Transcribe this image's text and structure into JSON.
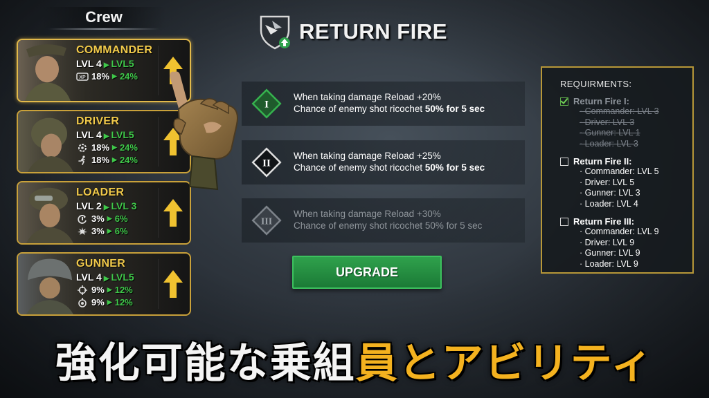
{
  "crew": {
    "title": "Crew",
    "members": [
      {
        "role": "COMMANDER",
        "level": "LVL 4",
        "next_level": "LVL5",
        "stats": [
          {
            "icon": "xp-icon",
            "value": "18%",
            "next": "24%"
          }
        ]
      },
      {
        "role": "DRIVER",
        "level": "LVL 4",
        "next_level": "LVL5",
        "stats": [
          {
            "icon": "gear-icon",
            "value": "18%",
            "next": "24%"
          },
          {
            "icon": "runner-icon",
            "value": "18%",
            "next": "24%"
          }
        ]
      },
      {
        "role": "LOADER",
        "level": "LVL 2",
        "next_level": "LVL 3",
        "stats": [
          {
            "icon": "reload-icon",
            "value": "3%",
            "next": "6%"
          },
          {
            "icon": "burst-icon",
            "value": "3%",
            "next": "6%"
          }
        ]
      },
      {
        "role": "GUNNER",
        "level": "LVL 4",
        "next_level": "LVL5",
        "stats": [
          {
            "icon": "crosshair-icon",
            "value": "9%",
            "next": "12%"
          },
          {
            "icon": "target-icon",
            "value": "9%",
            "next": "12%"
          }
        ]
      }
    ]
  },
  "ability": {
    "title": "RETURN FIRE",
    "tiers": [
      {
        "numeral": "I",
        "line1": "When taking damage Reload +20%",
        "line2_prefix": "Chance of enemy shot ricochet ",
        "line2_bold": "50% for 5 sec",
        "state": "active"
      },
      {
        "numeral": "II",
        "line1": "When taking damage Reload +25%",
        "line2_prefix": "Chance of enemy shot ricochet ",
        "line2_bold": "50% for 5 sec",
        "state": "available"
      },
      {
        "numeral": "III",
        "line1": "When taking damage Reload +30%",
        "line2_prefix": "Chance of enemy shot ricochet ",
        "line2_bold": "50% for 5 sec",
        "state": "locked"
      }
    ],
    "upgrade_label": "UPGRADE"
  },
  "requirements": {
    "title": "REQUIRMENTS:",
    "groups": [
      {
        "name": "Return Fire I:",
        "checked": true,
        "items": [
          "· Commander: LVL 3",
          "· Driver: LVL 3",
          "· Gunner: LVL 1",
          "· Loader: LVL 3"
        ]
      },
      {
        "name": "Return Fire II:",
        "checked": false,
        "items": [
          "· Commander: LVL 5",
          "· Driver: LVL 5",
          "· Gunner: LVL 3",
          "· Loader: LVL 4"
        ]
      },
      {
        "name": "Return Fire III:",
        "checked": false,
        "items": [
          "· Commander: LVL 9",
          "· Driver: LVL 9",
          "· Gunner: LVL 9",
          "· Loader: LVL 9"
        ]
      }
    ]
  },
  "banner": {
    "white_text": "強化可能な乗組",
    "yellow_text": "員とアビリティ"
  },
  "colors": {
    "accent_gold": "#c9a13a",
    "level_green": "#3fc84a",
    "upgrade_green": "#2fa14c",
    "banner_yellow": "#f4b21f"
  }
}
